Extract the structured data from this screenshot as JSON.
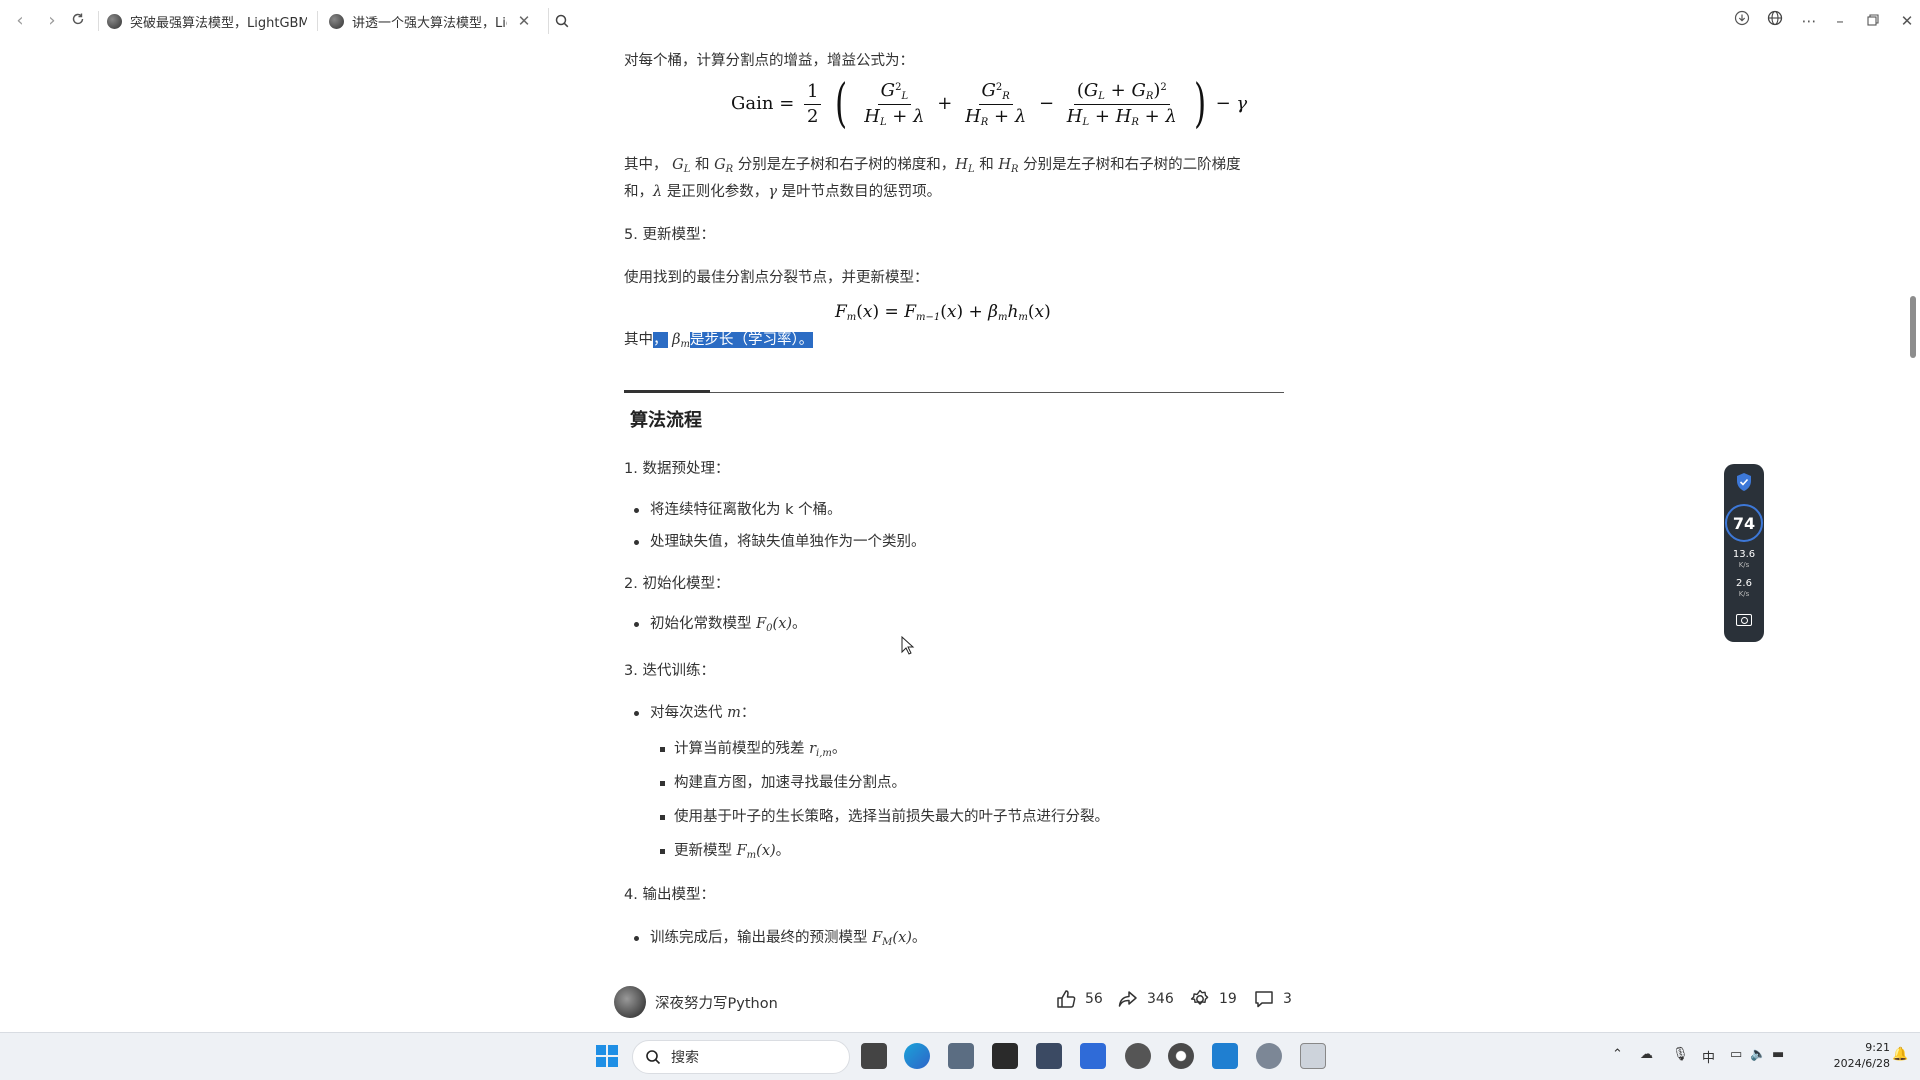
{
  "browser": {
    "tabs": [
      {
        "title": "突破最强算法模型，LightGBM！"
      },
      {
        "title": "讲透一个强大算法模型，LightGBM"
      }
    ]
  },
  "article": {
    "intro_gain": "对每个桶，计算分割点的增益，增益公式为：",
    "gain_label": "Gain",
    "gain_explain_1": "分别是左子树和右子树的梯度和，",
    "gain_explain_2": "分别是左子树和右子树的二阶梯度",
    "gain_explain_3a": "和，",
    "gain_explain_3b": "是正则化参数，",
    "gain_explain_3c": "是叶节点数目的惩罚项。",
    "qizhong": "其中，",
    "he": "和",
    "step5": "5. 更新模型：",
    "update_intro": "使用找到的最佳分割点分裂节点，并更新模型：",
    "beta_prefix": "其中",
    "beta_text": "是步长（学习率）。",
    "section_title": "算法流程",
    "s1_title": "1. 数据预处理：",
    "s1_items": [
      "将连续特征离散化为 k 个桶。",
      "处理缺失值，将缺失值单独作为一个类别。"
    ],
    "s2_title": "2. 初始化模型：",
    "s2_item": "初始化常数模型",
    "s3_title": "3. 迭代训练：",
    "s3_item": "对每次迭代",
    "s3_sub_1": "计算当前模型的残差",
    "s3_sub_2": "构建直方图，加速寻找最佳分割点。",
    "s3_sub_3": "使用基于叶子的生长策略，选择当前损失最大的叶子节点进行分裂。",
    "s3_sub_4": "更新模型",
    "s4_title": "4. 输出模型：",
    "s4_item": "训练完成后，输出最终的预测模型"
  },
  "footer": {
    "author": "深夜努力写Python",
    "likes": "56",
    "shares": "346",
    "collects": "19",
    "comments": "3"
  },
  "widget": {
    "score": "74",
    "up_rate": "13.6",
    "down_rate": "2.6",
    "unit": "K/s"
  },
  "taskbar": {
    "search_placeholder": "搜索",
    "ime": "中",
    "time": "9:21",
    "date": "2024/6/28"
  },
  "colors": {
    "selection": "#2b6cc4",
    "widget_bg": "#2a3139",
    "accent": "#3d78d8"
  }
}
